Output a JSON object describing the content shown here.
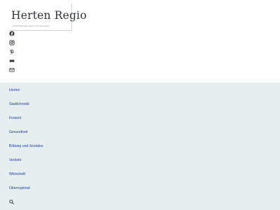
{
  "brand": {
    "title": "Herten Regio",
    "tagline": "Nachrichten aus Herten und der Region"
  },
  "social": [
    {
      "icon": "facebook-icon"
    },
    {
      "icon": "instagram-icon"
    },
    {
      "icon": "pinterest-icon"
    },
    {
      "icon": "flickr-icon"
    },
    {
      "icon": "email-icon"
    }
  ],
  "nav": {
    "items": [
      {
        "label": "Herten"
      },
      {
        "label": "Stadtchronik"
      },
      {
        "label": "Freizeit"
      },
      {
        "label": "Gesundheit"
      },
      {
        "label": "Bildung und Soziales"
      },
      {
        "label": "Verkehr"
      },
      {
        "label": "Wirtschaft"
      },
      {
        "label": "Überregional"
      }
    ]
  },
  "colors": {
    "nav_background": "#e7eeef",
    "link": "#1b3cc2",
    "icon": "#2f353a"
  }
}
